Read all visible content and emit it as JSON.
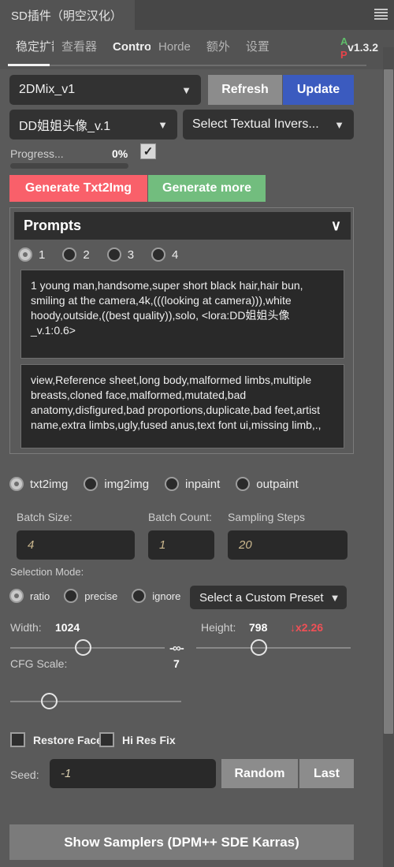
{
  "window": {
    "title": "SD插件（明空汉化）",
    "menu_icon": "hamburger-icon"
  },
  "nav": {
    "tabs": [
      {
        "label": "稳定扩散",
        "active": true
      },
      {
        "label": "查看器",
        "active": false
      },
      {
        "label": "ControlNet",
        "active": false
      },
      {
        "label": "Horde",
        "active": false
      },
      {
        "label": "额外",
        "active": false
      },
      {
        "label": "设置",
        "active": false
      }
    ],
    "logo_a": "A",
    "logo_p": "P",
    "version": "v1.3.2",
    "collapse_icon": "chevron-up-icon"
  },
  "models": {
    "checkpoint": "2DMix_v1",
    "refresh_label": "Refresh",
    "update_label": "Update",
    "lora": "DD姐姐头像_v.1",
    "textual_inversion": "Select Textual Invers..."
  },
  "progress": {
    "label": "Progress...",
    "percent": "0%",
    "value": 0,
    "live_preview_checked": true
  },
  "generate": {
    "txt2img_label": "Generate Txt2Img",
    "more_label": "Generate more",
    "txt2img_color": "#f9606a",
    "more_color": "#72bd7e"
  },
  "prompts": {
    "header": "Prompts",
    "collapse_icon": "chevron-down-icon",
    "slots": [
      {
        "label": "1",
        "selected": true
      },
      {
        "label": "2",
        "selected": false
      },
      {
        "label": "3",
        "selected": false
      },
      {
        "label": "4",
        "selected": false
      }
    ],
    "positive": "1 young man,handsome,super short black hair,hair bun, smiling at the camera,4k,(((looking at camera))),white hoody,outside,((best quality)),solo, <lora:DD姐姐头像_v.1:0.6>",
    "negative": "view,Reference sheet,long body,malformed limbs,multiple breasts,cloned face,malformed,mutated,bad anatomy,disfigured,bad proportions,duplicate,bad feet,artist name,extra limbs,ugly,fused anus,text font ui,missing limb,.,"
  },
  "mode": {
    "options": [
      {
        "label": "txt2img",
        "selected": true
      },
      {
        "label": "img2img",
        "selected": false
      },
      {
        "label": "inpaint",
        "selected": false
      },
      {
        "label": "outpaint",
        "selected": false
      }
    ]
  },
  "batch": {
    "batch_size_label": "Batch Size:",
    "batch_size_value": "4",
    "batch_count_label": "Batch Count:",
    "batch_count_value": "1",
    "sampling_steps_label": "Sampling Steps",
    "sampling_steps_value": "20"
  },
  "selection": {
    "label": "Selection Mode:",
    "options": [
      {
        "label": "ratio",
        "selected": true
      },
      {
        "label": "precise",
        "selected": false
      },
      {
        "label": "ignore",
        "selected": false
      }
    ],
    "preset": "Select a Custom Preset"
  },
  "dimensions": {
    "width_label": "Width:",
    "width_value": "1024",
    "height_label": "Height:",
    "height_value": "798",
    "ratio_badge": "↓x2.26",
    "ratio_badge_color": "#f05056",
    "link_icon": "chain-link-icon"
  },
  "cfg": {
    "label": "CFG Scale:",
    "value": "7"
  },
  "toggles": {
    "restore_faces_label": "Restore Faces",
    "restore_faces_checked": false,
    "hires_fix_label": "Hi Res Fix",
    "hires_fix_checked": false
  },
  "seed": {
    "label": "Seed:",
    "value": "-1",
    "random_label": "Random",
    "last_label": "Last"
  },
  "samplers": {
    "button_label": "Show Samplers (DPM++ SDE Karras)"
  }
}
